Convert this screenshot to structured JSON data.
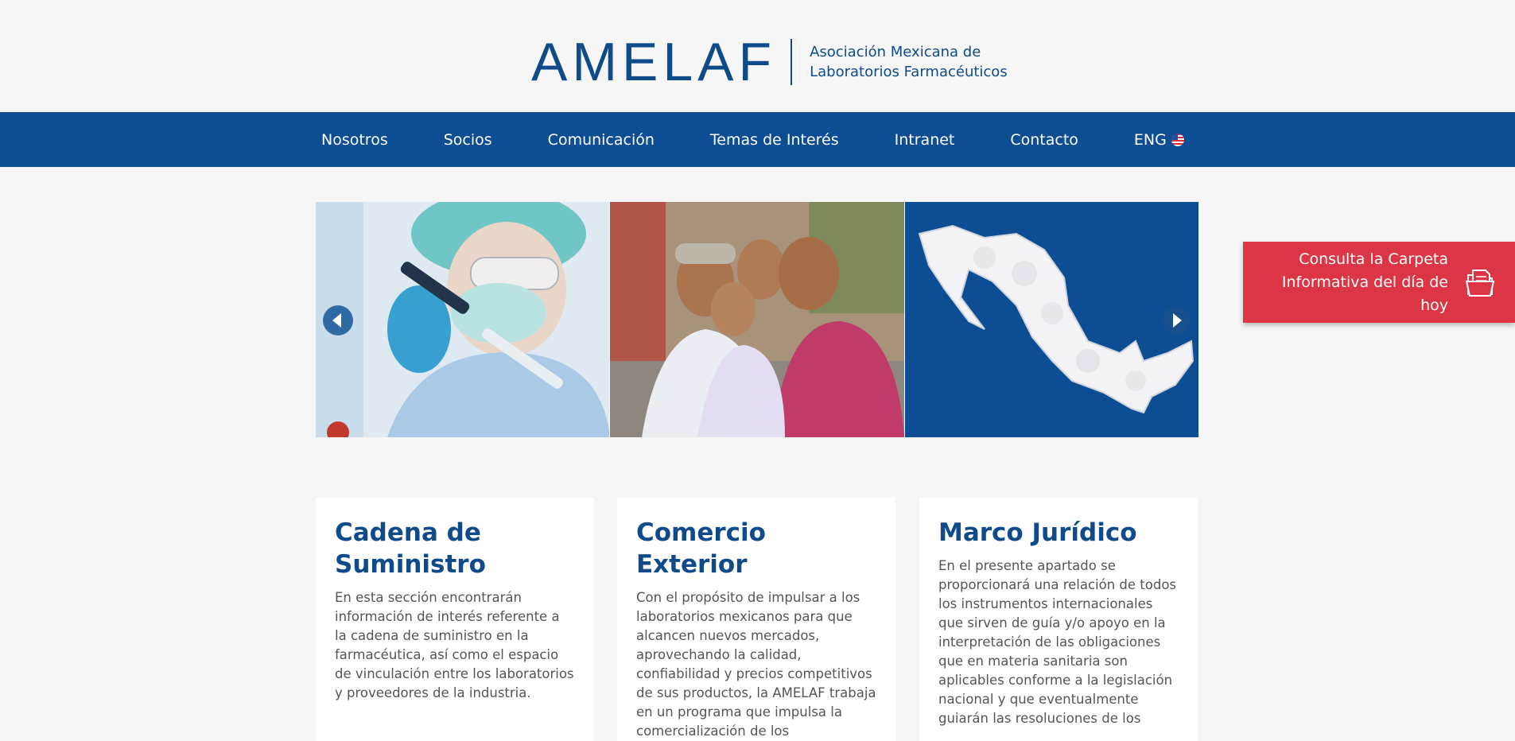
{
  "header": {
    "logo_text": "AMELAF",
    "tagline_line1": "Asociación Mexicana de",
    "tagline_line2": "Laboratorios Farmacéuticos"
  },
  "nav": {
    "items": [
      {
        "label": "Nosotros"
      },
      {
        "label": "Socios"
      },
      {
        "label": "Comunicación"
      },
      {
        "label": "Temas de Interés"
      },
      {
        "label": "Intranet"
      },
      {
        "label": "Contacto"
      },
      {
        "label": "ENG"
      }
    ]
  },
  "slider": {
    "slides": [
      "lab-scientist-image",
      "family-image",
      "mexico-pill-map-image"
    ]
  },
  "cta": {
    "label": "Consulta la Carpeta Informativa del día de hoy",
    "icon": "folder-document-icon"
  },
  "cards": [
    {
      "title": "Cadena de Suministro",
      "body": "En esta sección encontrarán información de interés referente a la cadena de suministro en la farmacéutica, así como el espacio de vinculación entre los laboratorios y proveedores de la industria."
    },
    {
      "title": "Comercio Exterior",
      "body": "Con el propósito de impulsar a los laboratorios mexicanos para que alcancen nuevos mercados, aprovechando la calidad, confiabilidad y precios competitivos de sus productos, la AMELAF trabaja en un programa que impulsa la comercialización de los medicamentos en varios países"
    },
    {
      "title": "Marco Jurídico",
      "body": "En el presente apartado se proporcionará una relación de todos los instrumentos internacionales que sirven de guía y/o apoyo en la interpretación de las obligaciones que en materia sanitaria son aplicables conforme a la legislación nacional y que eventualmente guiarán las resoluciones de los"
    }
  ],
  "colors": {
    "brand_blue": "#0d4d94",
    "cta_red": "#dc3545",
    "background": "#f6f6f6"
  }
}
